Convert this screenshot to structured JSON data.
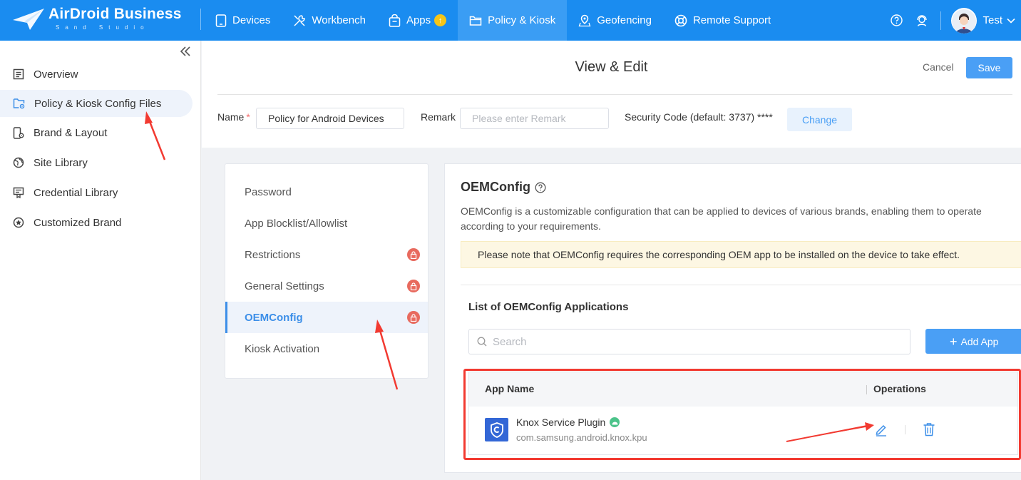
{
  "app": {
    "logo_text": "AirDroid Business",
    "logo_sub": "Sand Studio"
  },
  "nav": {
    "items": [
      {
        "label": "Devices",
        "icon": "tablet-icon"
      },
      {
        "label": "Workbench",
        "icon": "tools-icon"
      },
      {
        "label": "Apps",
        "icon": "apps-bag-icon",
        "badge": "↑"
      },
      {
        "label": "Policy & Kiosk",
        "icon": "folder-icon",
        "active": true
      },
      {
        "label": "Geofencing",
        "icon": "map-pin-icon"
      },
      {
        "label": "Remote Support",
        "icon": "lifebuoy-icon"
      }
    ],
    "user_name": "Test"
  },
  "sidebar": {
    "items": [
      {
        "label": "Overview",
        "icon": "list-icon"
      },
      {
        "label": "Policy & Kiosk Config Files",
        "icon": "folder-gear-icon",
        "active": true
      },
      {
        "label": "Brand & Layout",
        "icon": "phone-gear-icon"
      },
      {
        "label": "Site Library",
        "icon": "globe-icon"
      },
      {
        "label": "Credential Library",
        "icon": "certificate-icon"
      },
      {
        "label": "Customized Brand",
        "icon": "star-circle-icon"
      }
    ]
  },
  "header": {
    "title": "View & Edit",
    "cancel_label": "Cancel",
    "save_label": "Save",
    "name_label": "Name",
    "required_mark": "*",
    "name_value": "Policy for Android Devices",
    "remark_label": "Remark",
    "remark_placeholder": "Please enter Remark",
    "security_label": "Security Code (default: 3737) ****",
    "change_label": "Change"
  },
  "config_menu": {
    "items": [
      {
        "label": "Password",
        "locked": false
      },
      {
        "label": "App Blocklist/Allowlist",
        "locked": false
      },
      {
        "label": "Restrictions",
        "locked": true
      },
      {
        "label": "General Settings",
        "locked": true
      },
      {
        "label": "OEMConfig",
        "locked": true,
        "active": true
      },
      {
        "label": "Kiosk Activation",
        "locked": false
      }
    ]
  },
  "oem": {
    "title": "OEMConfig",
    "description": "OEMConfig is a customizable configuration that can be applied to devices of various brands, enabling them to operate according to your requirements.",
    "note": "Please note that OEMConfig requires the corresponding OEM app to be installed on the device to take effect.",
    "list_title": "List of OEMConfig Applications",
    "search_placeholder": "Search",
    "add_label": "Add App",
    "table": {
      "col_app_name": "App Name",
      "col_operations": "Operations",
      "rows": [
        {
          "name": "Knox Service Plugin",
          "package": "com.samsung.android.knox.kpu"
        }
      ]
    }
  },
  "colors": {
    "topbar": "#1a8cf0",
    "accent": "#4a9ff5",
    "annotation": "#f23a31"
  }
}
